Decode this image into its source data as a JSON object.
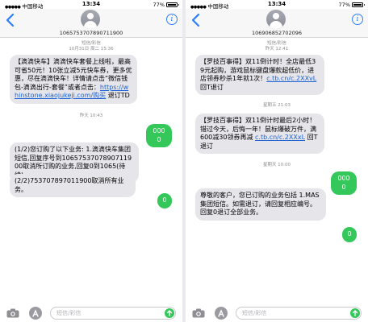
{
  "colors": {
    "accent": "#2d7ff9",
    "outgoing": "#34c759",
    "incoming": "#e5e5ea"
  },
  "icons": [
    "back-chevron-icon",
    "contact-avatar-icon",
    "info-icon",
    "camera-icon",
    "app-store-icon",
    "send-arrow-icon"
  ],
  "left": {
    "status": {
      "carrier": "中国移动",
      "time": "13:34",
      "battery": "77%"
    },
    "contact": "1065753707890711900",
    "timestamp1": "短信/彩信\n10月31日 周二 15:36",
    "msg1_a": "【滴滴快车】滴滴快车套餐上线啦，最高可省50元！10张立减5元快车券，更多优惠，尽在滴滴快车！详情请点击“微信钱包-滴滴出行-套餐”或者点击：",
    "msg1_link": "https://whinstone.xiaojukeji.com/购买",
    "msg1_b": " 退订TD",
    "timestamp2": "昨天 10:43",
    "out1": "0000",
    "msg2": "(1/2)您订购了以下业务: 1.滴滴快车集团短信,回复序号到1065753707890711900取消所订购的业务,回复0到1065(待续)",
    "msg3": "(2/2)753707897011900取消所有业务。",
    "out2": "0",
    "input_placeholder": "短信/彩信"
  },
  "right": {
    "status": {
      "carrier": "中国移动",
      "time": "13:34",
      "battery": "77%"
    },
    "contact": "106906852702096",
    "timestamp1": "短信/彩信\n昨天 12:41",
    "msg1_a": "【罗技百事得】双11倒计时！全店最低39元起购，游戏鼠标键盘爆款超低价，进店领券秒杀1年就1次！",
    "msg1_link": "c.tb.cn/c.2XXvL",
    "msg1_b": " 回T退订",
    "timestamp2": "星期五 21:03",
    "msg2_a": "【罗技百事得】双11倒计时最后2小时！错过今天，后悔一年！鼠标爆破万件，满600减30领券再减 ",
    "msg2_link": "c.tb.cn/c.2XXxL",
    "msg2_b": " 回T退订",
    "timestamp3": "星期天 10:00",
    "out1": "0000",
    "msg3": "尊敬的客户，您已订购的业务包括 1.MAS集团短信。如需退订，请回复相应编号。回复0退订全部业务。",
    "out2": "0",
    "input_placeholder": "短信/彩信"
  }
}
